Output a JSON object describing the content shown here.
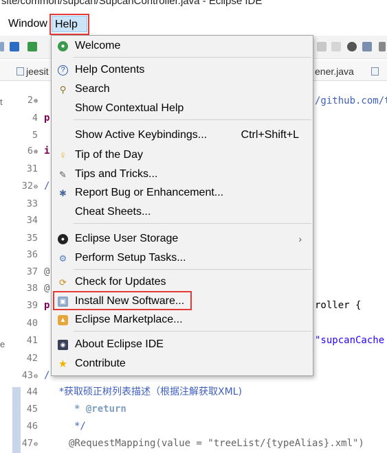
{
  "window": {
    "title": "site/common/supcan/SupcanController.java - Eclipse IDE"
  },
  "menubar": {
    "items": [
      "Window",
      "Help"
    ]
  },
  "tabs": [
    "jeesit",
    "ener.java"
  ],
  "editor": {
    "lines": [
      {
        "num": "2",
        "fold": "⊕",
        "code": ""
      },
      {
        "num": "4",
        "fold": "",
        "code": "p"
      },
      {
        "num": "5",
        "fold": "",
        "code": ""
      },
      {
        "num": "6",
        "fold": "⊕",
        "code": "i"
      },
      {
        "num": "31",
        "fold": "",
        "code": ""
      },
      {
        "num": "32",
        "fold": "⊖",
        "code": "/"
      },
      {
        "num": "33",
        "fold": "",
        "code": ""
      },
      {
        "num": "34",
        "fold": "",
        "code": ""
      },
      {
        "num": "35",
        "fold": "",
        "code": ""
      },
      {
        "num": "36",
        "fold": "",
        "code": ""
      },
      {
        "num": "37",
        "fold": "",
        "code": "@"
      },
      {
        "num": "38",
        "fold": "",
        "code": "@"
      },
      {
        "num": "39",
        "fold": "",
        "code": "p"
      },
      {
        "num": "40",
        "fold": "",
        "code": ""
      },
      {
        "num": "41",
        "fold": "",
        "code": ""
      },
      {
        "num": "42",
        "fold": "",
        "code": ""
      },
      {
        "num": "43",
        "fold": "⊖",
        "code": "/"
      },
      {
        "num": "44",
        "fold": "",
        "code": "*获取硕正树列表描述（根据注解获取XML)"
      },
      {
        "num": "45",
        "fold": "",
        "code": "* @return"
      },
      {
        "num": "46",
        "fold": "",
        "code": "*/"
      },
      {
        "num": "47",
        "fold": "⊖",
        "code": "@RequestMapping(value = \"treeList/{typeAlias}.xml\")"
      }
    ],
    "right_fragments": {
      "github": "/github.com/t",
      "roller": "roller {",
      "cache": "\"supcanCache"
    },
    "left_marks": [
      "t",
      "e"
    ]
  },
  "help_menu": {
    "items": [
      {
        "icon": "welcome-icon",
        "label": "Welcome",
        "shortcut": ""
      },
      {
        "icon": "help-contents-icon",
        "label": "Help Contents",
        "shortcut": ""
      },
      {
        "icon": "search-icon",
        "label": "Search",
        "shortcut": ""
      },
      {
        "icon": "",
        "label": "Show Contextual Help",
        "shortcut": ""
      },
      {
        "icon": "",
        "label": "Show Active Keybindings...",
        "shortcut": "Ctrl+Shift+L"
      },
      {
        "icon": "lightbulb-icon",
        "label": "Tip of the Day",
        "shortcut": ""
      },
      {
        "icon": "tips-icon",
        "label": "Tips and Tricks...",
        "shortcut": ""
      },
      {
        "icon": "bug-icon",
        "label": "Report Bug or Enhancement...",
        "shortcut": ""
      },
      {
        "icon": "",
        "label": "Cheat Sheets...",
        "shortcut": ""
      },
      {
        "icon": "user-storage-icon",
        "label": "Eclipse User Storage",
        "shortcut": ""
      },
      {
        "icon": "setup-tasks-icon",
        "label": "Perform Setup Tasks...",
        "shortcut": ""
      },
      {
        "icon": "update-icon",
        "label": "Check for Updates",
        "shortcut": ""
      },
      {
        "icon": "install-software-icon",
        "label": "Install New Software...",
        "shortcut": ""
      },
      {
        "icon": "marketplace-icon",
        "label": "Eclipse Marketplace...",
        "shortcut": ""
      },
      {
        "icon": "eclipse-icon",
        "label": "About Eclipse IDE",
        "shortcut": ""
      },
      {
        "icon": "star-icon",
        "label": "Contribute",
        "shortcut": ""
      }
    ]
  },
  "colors": {
    "highlight_box": "#e53935",
    "menu_background": "#f2f2f2",
    "keyword": "#7f0055",
    "string": "#2a00ff",
    "javadoc": "#3f5fbf"
  }
}
